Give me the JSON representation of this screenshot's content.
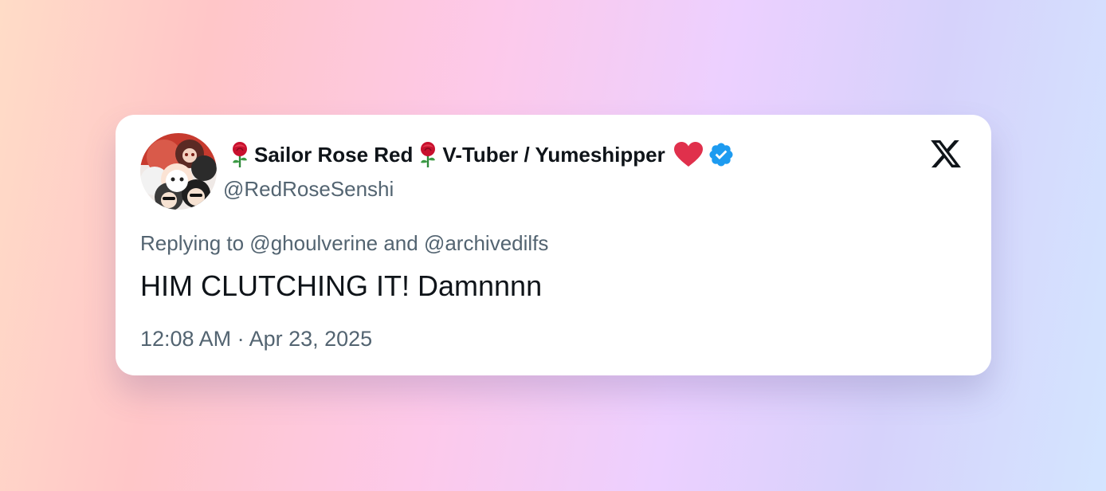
{
  "tweet": {
    "author": {
      "name_part_1": "Sailor Rose Red",
      "name_part_2": "V-Tuber / Yumeshipper",
      "handle": "@RedRoseSenshi",
      "verified": true,
      "avatar_icon": "avatar-chibi-group-image",
      "name_icons": [
        "rose-icon",
        "rose-icon",
        "red-heart-icon",
        "verified-badge-icon"
      ]
    },
    "platform_icon": "x-logo-icon",
    "reply_to": "Replying to @ghoulverine and @archivedilfs",
    "text": "HIM CLUTCHING IT! Damnnnn",
    "timestamp": "12:08 AM · Apr 23, 2025"
  },
  "colors": {
    "text_primary": "#0f1419",
    "text_secondary": "#536471",
    "verified_blue": "#1d9bf0",
    "heart_red": "#e0304c",
    "card_background": "#ffffff"
  }
}
